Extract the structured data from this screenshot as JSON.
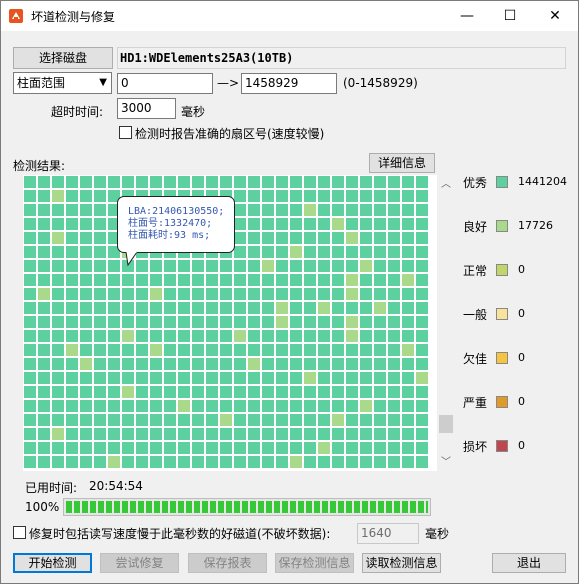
{
  "window": {
    "title": "坏道检测与修复",
    "minimize_glyph": "—",
    "maximize_glyph": "☐",
    "close_glyph": "✕"
  },
  "toolbar": {
    "select_disk_label": "选择磁盘",
    "disk_name": "HD1:WDElements25A3(10TB)"
  },
  "range": {
    "mode_value": "柱面范围",
    "start_value": "0",
    "arrow": "—>",
    "end_value": "1458929",
    "hint": "(0-1458929)"
  },
  "timeout": {
    "label": "超时时间:",
    "value": "3000",
    "unit": "毫秒"
  },
  "report_sector_option": {
    "label": "检测时报告准确的扇区号(速度较慢)",
    "checked": false
  },
  "results": {
    "label": "检测结果:",
    "details_button": "详细信息"
  },
  "legend": [
    {
      "label": "优秀",
      "count": "1441204",
      "color": "#5dd0a0"
    },
    {
      "label": "良好",
      "count": "17726",
      "color": "#a9d98a"
    },
    {
      "label": "正常",
      "count": "0",
      "color": "#c0d66a"
    },
    {
      "label": "一般",
      "count": "0",
      "color": "#f7e39a"
    },
    {
      "label": "欠佳",
      "count": "0",
      "color": "#f5c542"
    },
    {
      "label": "严重",
      "count": "0",
      "color": "#e09a2a"
    },
    {
      "label": "损坏",
      "count": "0",
      "color": "#c0474d"
    }
  ],
  "tooltip": {
    "line1": "LBA:21406130550;",
    "line2": "柱面号:1332470;",
    "line3": "柱面耗时:93 ms;"
  },
  "elapsed": {
    "label": "已用时间:",
    "value": "20:54:54"
  },
  "progress": {
    "percent_label": "100%",
    "fraction": 1.0
  },
  "repair_option": {
    "label": "修复时包括读写速度慢于此毫秒数的好磁道(不破坏数据):",
    "value": "1640",
    "unit": "毫秒",
    "checked": false
  },
  "buttons": {
    "start": "开始检测",
    "try_repair": "尝试修复",
    "save_report": "保存报表",
    "save_info": "保存检测信息",
    "load_info": "读取检测信息",
    "exit": "退出"
  },
  "scrollbar": {
    "up_glyph": "︿",
    "down_glyph": "﹀"
  }
}
